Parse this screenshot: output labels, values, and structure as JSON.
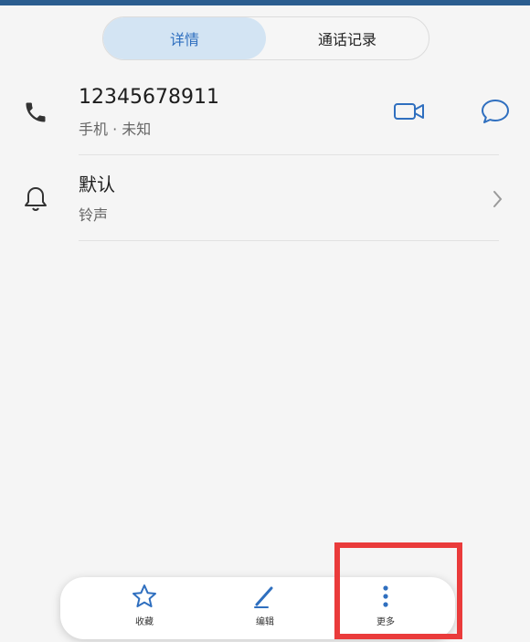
{
  "tabs": {
    "active": "详情",
    "inactive": "通话记录"
  },
  "contact": {
    "phone_number": "12345678911",
    "phone_label": "手机 · 未知"
  },
  "ringtone": {
    "value": "默认",
    "label": "铃声"
  },
  "bottom_bar": {
    "favorite": "收藏",
    "edit": "编辑",
    "more": "更多"
  },
  "colors": {
    "accent": "#2f6fbf",
    "active_tab_bg": "#d3e4f3",
    "highlight": "#ea3b3b",
    "background": "#f5f5f5"
  },
  "icons": {
    "phone": "phone-icon",
    "video": "video-call-icon",
    "message": "message-icon",
    "bell": "bell-icon",
    "chevron": "chevron-right-icon",
    "star": "star-icon",
    "pencil": "pencil-icon",
    "more": "more-vertical-icon"
  }
}
